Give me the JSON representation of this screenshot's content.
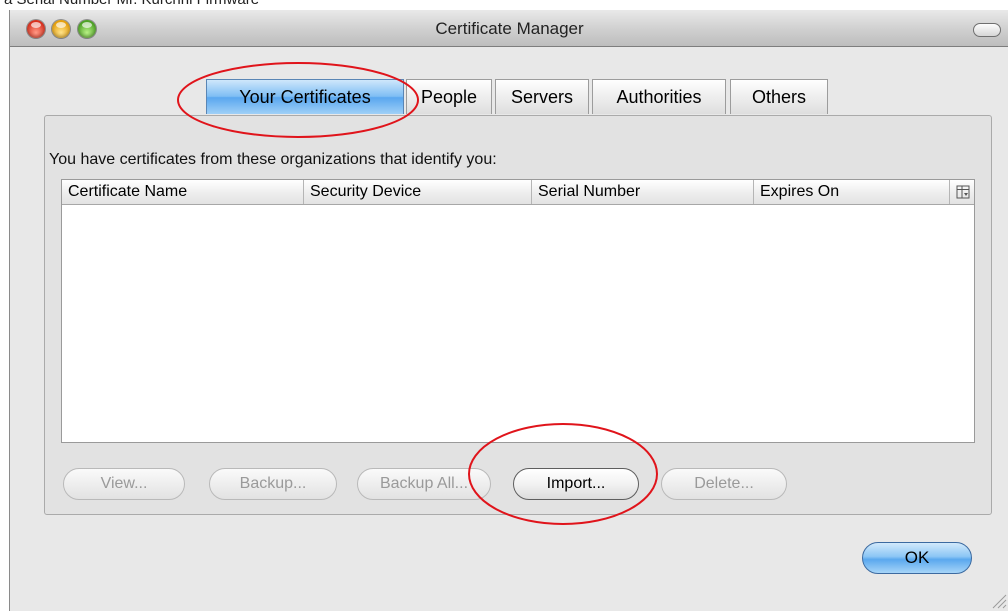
{
  "background_window": {
    "text": "a Serial Number Mr. Kurchnl Firmware"
  },
  "window": {
    "title": "Certificate Manager"
  },
  "tabs": [
    {
      "label": "Your Certificates",
      "active": true
    },
    {
      "label": "People",
      "active": false
    },
    {
      "label": "Servers",
      "active": false
    },
    {
      "label": "Authorities",
      "active": false
    },
    {
      "label": "Others",
      "active": false
    }
  ],
  "panel": {
    "intro": "You have certificates from these organizations that identify you:"
  },
  "table": {
    "columns": [
      "Certificate Name",
      "Security Device",
      "Serial Number",
      "Expires On"
    ],
    "rows": []
  },
  "buttons": {
    "view": "View...",
    "backup": "Backup...",
    "backup_all": "Backup All...",
    "import": "Import...",
    "delete": "Delete..."
  },
  "ok": "OK",
  "colors": {
    "accent_blue": "#5aa7ef",
    "annotation_red": "#e0141b"
  },
  "icons": [
    "close-window-icon",
    "minimize-window-icon",
    "zoom-window-icon",
    "toolbar-toggle-icon",
    "column-picker-icon",
    "resize-grip-icon"
  ]
}
